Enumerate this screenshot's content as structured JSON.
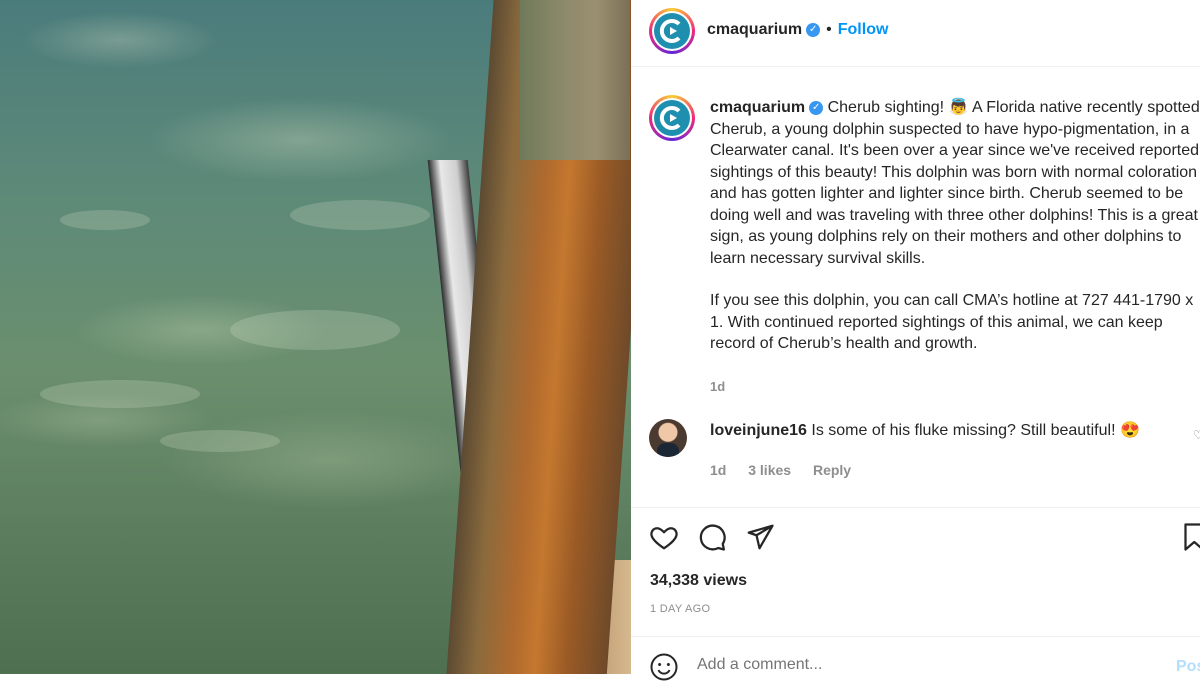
{
  "post": {
    "username": "cmaquarium",
    "verified_icon": "verified-badge-icon",
    "follow_label": "Follow",
    "more_label": "..."
  },
  "caption": {
    "username": "cmaquarium",
    "paragraph1": "Cherub sighting! 👼  A Florida native recently spotted Cherub, a young dolphin suspected to have hypo-pigmentation, in a Clearwater canal. It's been over a year since we've received reported sightings of this beauty! This dolphin was born with normal coloration and has gotten lighter and lighter since birth. Cherub seemed to be doing well and was traveling with three other dolphins! This is a great sign, as young dolphins rely on their mothers and other dolphins to learn necessary survival skills.",
    "paragraph2": "If you see this dolphin, you can call CMA’s hotline at 727 441-1790 x 1. With continued reported sightings of this animal, we can keep record of Cherub’s health and growth.",
    "age": "1d"
  },
  "comment": {
    "username": "loveinjune16",
    "text": "Is some of his fluke missing? Still beautiful! 😍",
    "age": "1d",
    "likes": "3 likes",
    "reply_label": "Reply"
  },
  "stats": {
    "views": "34,338 views",
    "posted": "1 DAY AGO"
  },
  "add_comment": {
    "placeholder": "Add a comment...",
    "post_label": "Post"
  },
  "colors": {
    "link_blue": "#0095f6",
    "muted": "#8e8e8e",
    "text": "#262626"
  }
}
